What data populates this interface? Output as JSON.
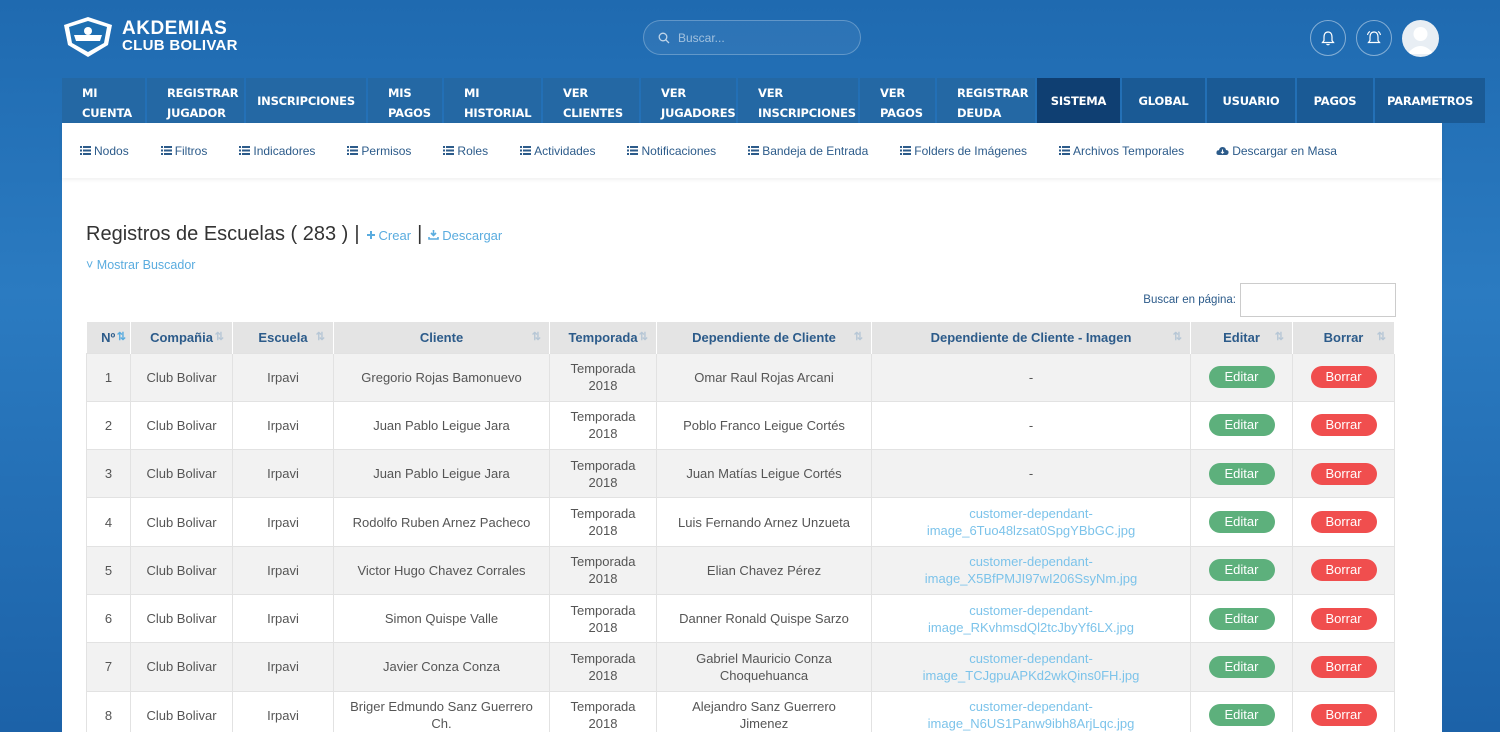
{
  "brand": {
    "line1": "AKDEMIAS",
    "line2": "CLUB BOLIVAR"
  },
  "search": {
    "placeholder": "Buscar..."
  },
  "nav": [
    {
      "l1": "MI",
      "l2": "CUENTA",
      "w": 83
    },
    {
      "l1": "REGISTRAR",
      "l2": "JUGADOR",
      "w": 97
    },
    {
      "l1": "INSCRIPCIONES",
      "l2": "",
      "w": 120
    },
    {
      "l1": "MIS",
      "l2": "PAGOS",
      "w": 74
    },
    {
      "l1": "MI",
      "l2": "HISTORIAL",
      "w": 97
    },
    {
      "l1": "VER",
      "l2": "CLIENTES",
      "w": 96
    },
    {
      "l1": "VER",
      "l2": "JUGADORES",
      "w": 95
    },
    {
      "l1": "VER",
      "l2": "INSCRIPCIONES",
      "w": 120
    },
    {
      "l1": "VER",
      "l2": "PAGOS",
      "w": 75
    },
    {
      "l1": "REGISTRAR",
      "l2": "DEUDA",
      "w": 98
    },
    {
      "l1": "SISTEMA",
      "l2": "",
      "w": 83
    },
    {
      "l1": "GLOBAL",
      "l2": "",
      "w": 83
    },
    {
      "l1": "USUARIO",
      "l2": "",
      "w": 88
    },
    {
      "l1": "PAGOS",
      "l2": "",
      "w": 76
    },
    {
      "l1": "PARAMETROS",
      "l2": "",
      "w": 110
    }
  ],
  "subnav": [
    "Nodos",
    "Filtros",
    "Indicadores",
    "Permisos",
    "Roles",
    "Actividades",
    "Notificaciones",
    "Bandeja de Entrada",
    "Folders de Imágenes",
    "Archivos Temporales",
    "Descargar en Masa"
  ],
  "page": {
    "title": "Registros de Escuelas ( 283 )",
    "create": "Crear",
    "download": "Descargar",
    "toggle": "Mostrar Buscador",
    "search_label": "Buscar en página:"
  },
  "table": {
    "headers": [
      "Nº",
      "Compañia",
      "Escuela",
      "Cliente",
      "Temporada",
      "Dependiente de Cliente",
      "Dependiente de Cliente - Imagen",
      "Editar",
      "Borrar"
    ],
    "edit_label": "Editar",
    "delete_label": "Borrar",
    "rows": [
      [
        "1",
        "Club Bolivar",
        "Irpavi",
        "Gregorio Rojas Bamonuevo",
        "Temporada 2018",
        "Omar Raul Rojas Arcani",
        "-"
      ],
      [
        "2",
        "Club Bolivar",
        "Irpavi",
        "Juan Pablo Leigue Jara",
        "Temporada 2018",
        "Poblo Franco Leigue Cortés",
        "-"
      ],
      [
        "3",
        "Club Bolivar",
        "Irpavi",
        "Juan Pablo Leigue Jara",
        "Temporada 2018",
        "Juan Matías Leigue Cortés",
        "-"
      ],
      [
        "4",
        "Club Bolivar",
        "Irpavi",
        "Rodolfo Ruben Arnez Pacheco",
        "Temporada 2018",
        "Luis Fernando Arnez Unzueta",
        "customer-dependant-image_6Tuo48lzsat0SpgYBbGC.jpg"
      ],
      [
        "5",
        "Club Bolivar",
        "Irpavi",
        "Victor Hugo Chavez Corrales",
        "Temporada 2018",
        "Elian Chavez Pérez",
        "customer-dependant-image_X5BfPMJI97wI206SsyNm.jpg"
      ],
      [
        "6",
        "Club Bolivar",
        "Irpavi",
        "Simon Quispe Valle",
        "Temporada 2018",
        "Danner Ronald Quispe Sarzo",
        "customer-dependant-image_RKvhmsdQl2tcJbyYf6LX.jpg"
      ],
      [
        "7",
        "Club Bolivar",
        "Irpavi",
        "Javier Conza Conza",
        "Temporada 2018",
        "Gabriel Mauricio Conza Choquehuanca",
        "customer-dependant-image_TCJgpuAPKd2wkQins0FH.jpg"
      ],
      [
        "8",
        "Club Bolivar",
        "Irpavi",
        "Briger Edmundo Sanz Guerrero Ch.",
        "Temporada 2018",
        "Alejandro Sanz Guerrero Jimenez",
        "customer-dependant-image_N6US1Panw9ibh8ArjLqc.jpg"
      ]
    ]
  },
  "colors": {
    "accent": "#2468a4",
    "active": "#0f3f72",
    "link": "#5aacdf",
    "edit": "#5db07c",
    "delete": "#f04e4e"
  }
}
